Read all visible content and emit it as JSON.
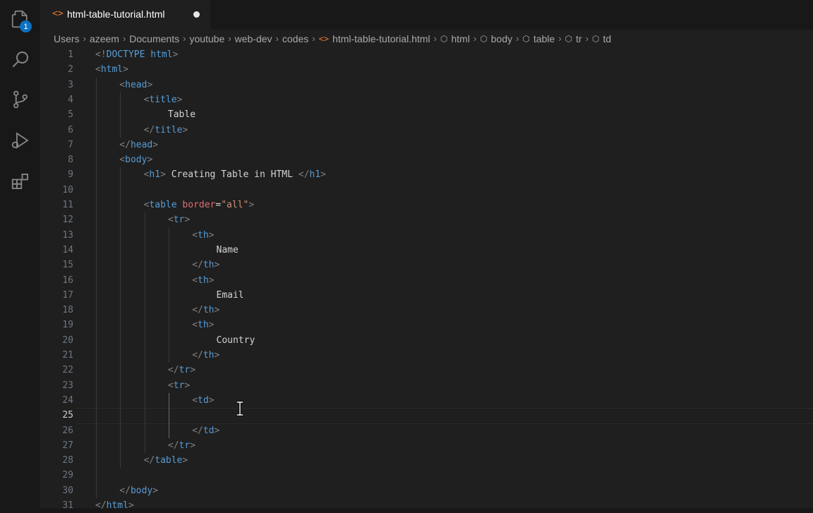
{
  "tab": {
    "title": "html-table-tutorial.html",
    "icon": "html-file-icon",
    "modified": true
  },
  "breadcrumb": [
    "Users",
    "azeem",
    "Documents",
    "youtube",
    "web-dev",
    "codes",
    "html-table-tutorial.html",
    "html",
    "body",
    "table",
    "tr",
    "td"
  ],
  "badge": "1",
  "active_line": 25,
  "code_lines": [
    [
      "1",
      "<!DOCTYPE html>"
    ],
    [
      "2",
      "<html>"
    ],
    [
      "3",
      "<head>"
    ],
    [
      "4",
      "<title>"
    ],
    [
      "5",
      "Table"
    ],
    [
      "6",
      "</title>"
    ],
    [
      "7",
      "</head>"
    ],
    [
      "8",
      "<body>"
    ],
    [
      "9",
      "<h1> Creating Table in HTML </h1>"
    ],
    [
      "10",
      ""
    ],
    [
      "11",
      "<table border=\"all\">"
    ],
    [
      "12",
      "<tr>"
    ],
    [
      "13",
      "<th>"
    ],
    [
      "14",
      "Name"
    ],
    [
      "15",
      "</th>"
    ],
    [
      "16",
      "<th>"
    ],
    [
      "17",
      "Email"
    ],
    [
      "18",
      "</th>"
    ],
    [
      "19",
      "<th>"
    ],
    [
      "20",
      "Country"
    ],
    [
      "21",
      "</th>"
    ],
    [
      "22",
      "</tr>"
    ],
    [
      "23",
      "<tr>"
    ],
    [
      "24",
      "<td>"
    ],
    [
      "25",
      ""
    ],
    [
      "26",
      "</td>"
    ],
    [
      "27",
      "</tr>"
    ],
    [
      "28",
      "</table>"
    ],
    [
      "29",
      ""
    ],
    [
      "30",
      "</body>"
    ],
    [
      "31",
      "</html>"
    ]
  ]
}
